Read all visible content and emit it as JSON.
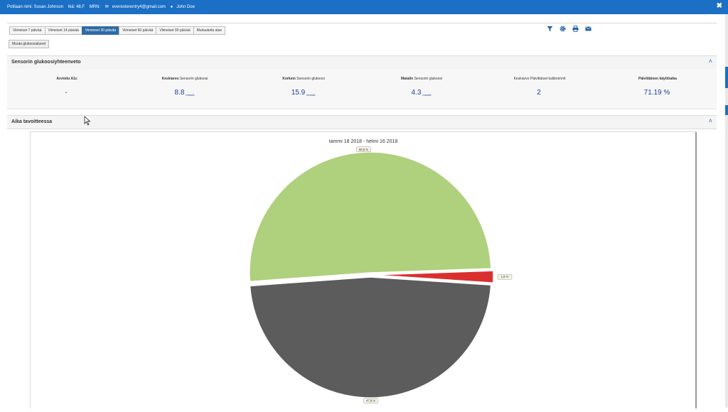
{
  "header": {
    "patient_name": "Potilaan nimi: Susan Johnson",
    "age": "Ikä: 48,F",
    "mrn": "MRN:",
    "email": "everesterentry4@gmail.com",
    "clinician": "John Doe"
  },
  "tabs": [
    {
      "label": "Viimeiset 7 päivää",
      "active": false
    },
    {
      "label": "Viimeiset 14 päivää",
      "active": false
    },
    {
      "label": "Viimeiset 30 päivää",
      "active": true
    },
    {
      "label": "Viimeiset 60 päivää",
      "active": false
    },
    {
      "label": "Viimeiset 90 päivää",
      "active": false
    },
    {
      "label": "Mukautettu alue",
      "active": false
    }
  ],
  "toolbar_icons": [
    "filter-icon",
    "gear-icon",
    "print-icon",
    "envelope-icon"
  ],
  "modify_button": "Muuta glukoosialueet",
  "summary": {
    "title": "Sensorin glukoosiyhteenveto",
    "stats": [
      {
        "label_bold": "Arvioitu A1c",
        "label_rest": "",
        "value": "-",
        "unit": ""
      },
      {
        "label_bold": "Keskiarvo",
        "label_rest": " Sensorin glukoosi",
        "value": "8.8",
        "unit": "mmol/L"
      },
      {
        "label_bold": "Korkein",
        "label_rest": " Sensorin glukoosi",
        "value": "15.9",
        "unit": "mmol/L"
      },
      {
        "label_bold": "Matalin",
        "label_rest": " Sensorin glukoosi",
        "value": "4.3",
        "unit": "mmol/L"
      },
      {
        "label_bold": "",
        "label_rest": "Keskiarvo Päivittäiset kalibroinnit",
        "value": "2",
        "unit": ""
      },
      {
        "label_bold": "Päivittäinen käyttöaika",
        "label_rest": "",
        "value": "71.19 %",
        "unit": ""
      }
    ]
  },
  "time_in_target": {
    "title": "Aika tavoitteessa"
  },
  "colors": {
    "topbar": "#1b6fc4",
    "active_tab": "#2d6aa6",
    "value_text": "#1f3c9e",
    "slice_green": "#afd07c",
    "slice_red": "#d9302f",
    "slice_gray": "#5c5c5c"
  },
  "chart_data": {
    "type": "pie",
    "title": "tammi 18 2018 - helmi 16 2018",
    "slices": [
      {
        "value": 50.6,
        "label": "50,6 %",
        "color": "#afd07c"
      },
      {
        "value": 1.6,
        "label": "1,6 %",
        "color": "#d9302f"
      },
      {
        "value": 47.8,
        "label": "47,8 %",
        "color": "#5c5c5c"
      }
    ]
  }
}
